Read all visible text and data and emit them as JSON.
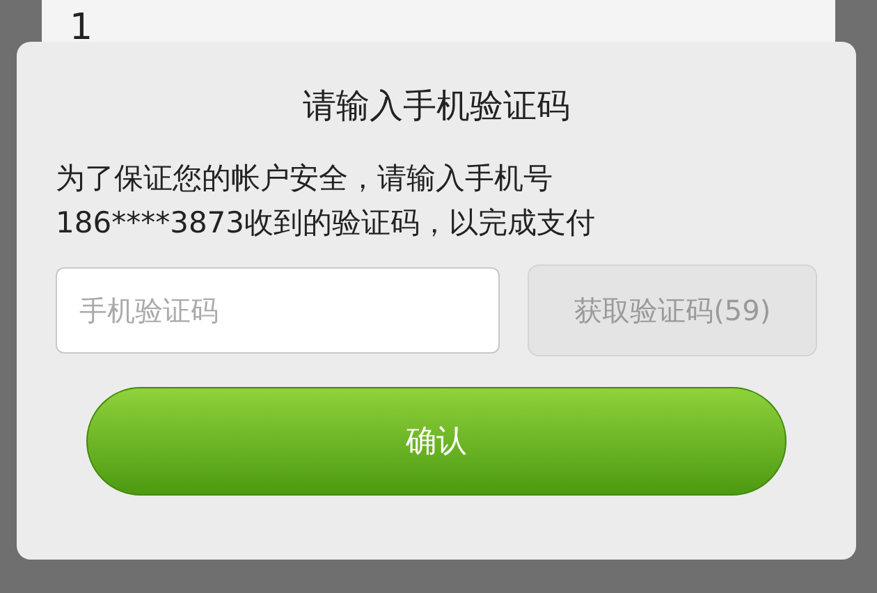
{
  "background": {
    "text": "1"
  },
  "dialog": {
    "title": "请输入手机验证码",
    "message_lines": [
      "为了保证您的帐户安全，请输入手机号",
      "186****3873收到的验证码，以完成支付"
    ],
    "code_field": {
      "placeholder": "手机验证码"
    },
    "resend_button": {
      "label": "获取验证码(59)",
      "disabled": true
    },
    "confirm_button": {
      "label": "确认"
    }
  }
}
